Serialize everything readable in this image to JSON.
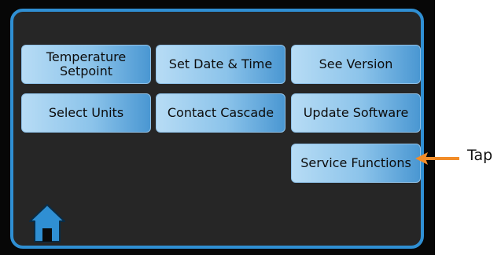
{
  "menu": {
    "buttons": [
      {
        "id": "temperature-setpoint",
        "label": "Temperature Setpoint"
      },
      {
        "id": "set-date-time",
        "label": "Set Date & Time"
      },
      {
        "id": "see-version",
        "label": "See Version"
      },
      {
        "id": "select-units",
        "label": "Select Units"
      },
      {
        "id": "contact-cascade",
        "label": "Contact Cascade"
      },
      {
        "id": "update-software",
        "label": "Update Software"
      },
      {
        "id": "service-functions",
        "label": "Service Functions"
      }
    ]
  },
  "footer": {
    "home_icon": "home-icon"
  },
  "annotation": {
    "tap_label": "Tap",
    "arrow_color": "#f28c28"
  },
  "colors": {
    "border_accent": "#2f8fd3",
    "button_light": "#b7dcf5",
    "button_dark": "#4a97d2",
    "home_icon": "#2f8fd3"
  }
}
